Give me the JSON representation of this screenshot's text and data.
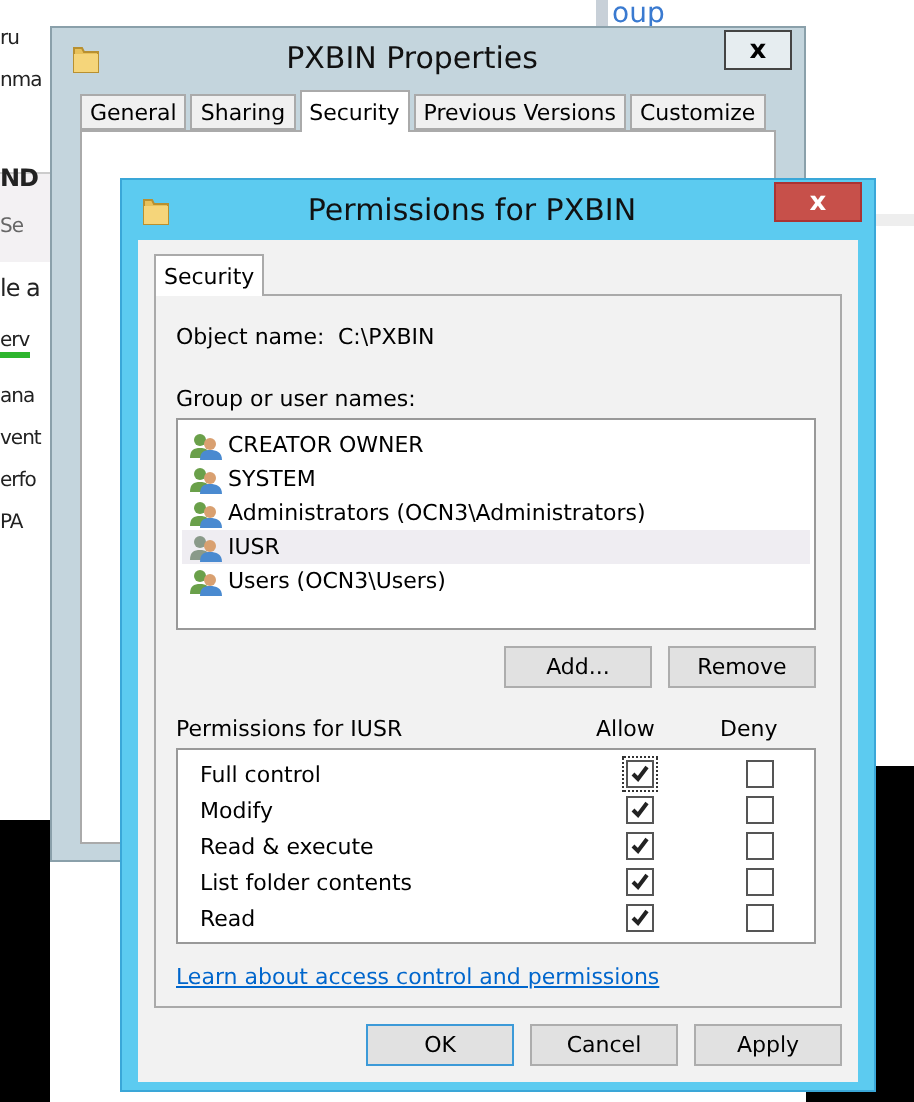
{
  "background_app": {
    "corner_link": "oup",
    "fragments": [
      {
        "text": "ru",
        "kind": "plain"
      },
      {
        "text": "nma",
        "kind": "plain"
      },
      {
        "text": "ND",
        "kind": "heading"
      },
      {
        "text": "Se",
        "kind": "sub"
      },
      {
        "text": "le a",
        "kind": "large"
      },
      {
        "text": "erv",
        "kind": "underlined"
      },
      {
        "text": "ana",
        "kind": "plain"
      },
      {
        "text": "vent",
        "kind": "plain"
      },
      {
        "text": "erfo",
        "kind": "plain"
      },
      {
        "text": "PA",
        "kind": "plain"
      }
    ]
  },
  "properties_window": {
    "title": "PXBIN Properties",
    "close": "x",
    "tabs": [
      {
        "label": "General",
        "selected": false
      },
      {
        "label": "Sharing",
        "selected": false
      },
      {
        "label": "Security",
        "selected": true
      },
      {
        "label": "Previous Versions",
        "selected": false
      },
      {
        "label": "Customize",
        "selected": false
      }
    ]
  },
  "permissions_window": {
    "title": "Permissions for PXBIN",
    "close": "x",
    "tabs": [
      {
        "label": "Security",
        "selected": true
      }
    ],
    "object_name_label": "Object name:",
    "object_name": "C:\\PXBIN",
    "groups_label": "Group or user names:",
    "groups": [
      {
        "name": "CREATOR OWNER",
        "selected": false
      },
      {
        "name": "SYSTEM",
        "selected": false
      },
      {
        "name": "Administrators (OCN3\\Administrators)",
        "selected": false
      },
      {
        "name": "IUSR",
        "selected": true
      },
      {
        "name": "Users (OCN3\\Users)",
        "selected": false
      }
    ],
    "group_buttons": [
      "Add...",
      "Remove"
    ],
    "permissions_label": "Permissions for IUSR",
    "allow_header": "Allow",
    "deny_header": "Deny",
    "permissions": [
      {
        "name": "Full control",
        "allow": true,
        "deny": false,
        "focused": true
      },
      {
        "name": "Modify",
        "allow": true,
        "deny": false,
        "focused": false
      },
      {
        "name": "Read & execute",
        "allow": true,
        "deny": false,
        "focused": false
      },
      {
        "name": "List folder contents",
        "allow": true,
        "deny": false,
        "focused": false
      },
      {
        "name": "Read",
        "allow": true,
        "deny": false,
        "focused": false
      }
    ],
    "link": "Learn about access control and permissions",
    "buttons": [
      {
        "label": "OK",
        "kind": "default"
      },
      {
        "label": "Cancel",
        "kind": "normal"
      },
      {
        "label": "Apply",
        "kind": "normal"
      }
    ]
  }
}
